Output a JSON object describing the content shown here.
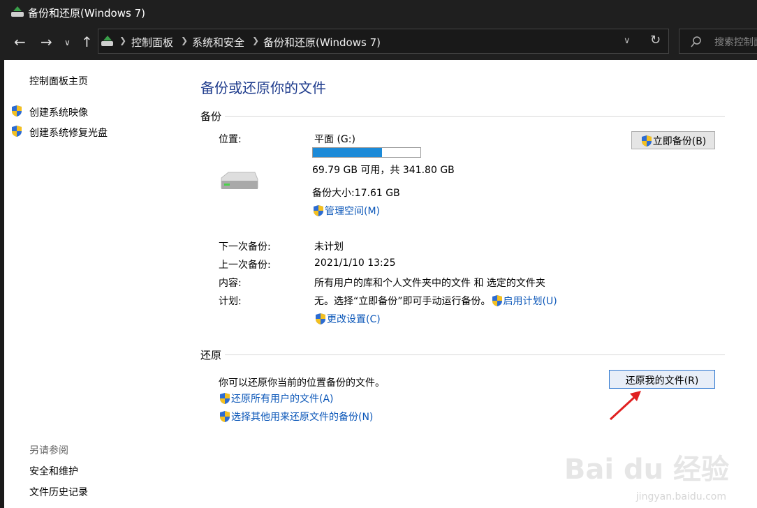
{
  "window": {
    "title": "备份和还原(Windows 7)"
  },
  "address_bar": {
    "crumbs": [
      "控制面板",
      "系统和安全",
      "备份和还原(Windows 7)"
    ],
    "search_placeholder": "搜索控制面板"
  },
  "sidebar": {
    "home": "控制面板主页",
    "tasks": [
      "创建系统映像",
      "创建系统修复光盘"
    ],
    "see_also_heading": "另请参阅",
    "see_also": [
      "安全和维护",
      "文件历史记录"
    ]
  },
  "main": {
    "title": "备份或还原你的文件",
    "backup": {
      "heading": "备份",
      "location_label": "位置:",
      "location_value": "平面 (G:)",
      "used_fraction": 0.64,
      "free_text": "69.79 GB 可用，共 341.80 GB",
      "size_text": "备份大小:17.61 GB",
      "manage_space": "管理空间(M)",
      "backup_now": "立即备份(B)",
      "next_label": "下一次备份:",
      "next_value": "未计划",
      "last_label": "上一次备份:",
      "last_value": "2021/1/10 13:25",
      "contents_label": "内容:",
      "contents_value": "所有用户的库和个人文件夹中的文件 和 选定的文件夹",
      "schedule_label": "计划:",
      "schedule_value": "无。选择“立即备份”即可手动运行备份。",
      "enable_schedule": "启用计划(U)",
      "change_settings": "更改设置(C)"
    },
    "restore": {
      "heading": "还原",
      "description": "你可以还原你当前的位置备份的文件。",
      "restore_my_files": "还原我的文件(R)",
      "restore_all_users": "还原所有用户的文件(A)",
      "select_other": "选择其他用来还原文件的备份(N)"
    }
  },
  "watermark": {
    "brand": "Bai du 经验",
    "url": "jingyan.baidu.com"
  },
  "colors": {
    "link": "#0a56b8",
    "title": "#1e3b8c",
    "accent_arrow": "#e02020",
    "progress": "#1b8ad8"
  }
}
